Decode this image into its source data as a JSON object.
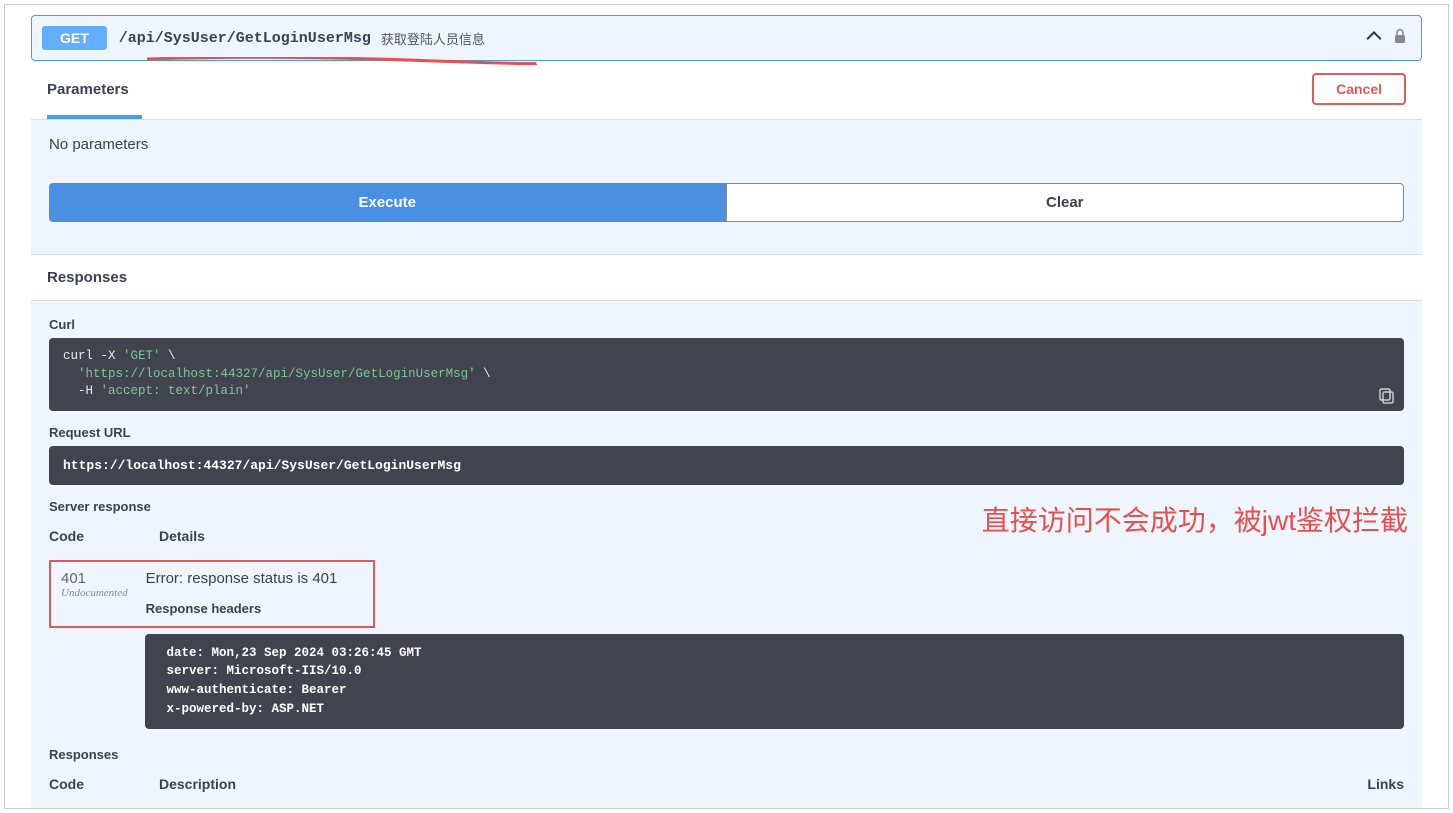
{
  "op": {
    "method": "GET",
    "path": "/api/SysUser/GetLoginUserMsg",
    "summary": "获取登陆人员信息"
  },
  "sections": {
    "parameters": "Parameters",
    "cancel": "Cancel",
    "noparams": "No parameters",
    "execute": "Execute",
    "clear": "Clear",
    "responses": "Responses",
    "curl": "Curl",
    "request_url": "Request URL",
    "server_response": "Server response",
    "code": "Code",
    "details": "Details",
    "description": "Description",
    "links": "Links",
    "responses2": "Responses"
  },
  "curl": {
    "l1a": "curl -X ",
    "l1b": "'GET'",
    "l1c": " \\",
    "l2a": "  ",
    "l2b": "'https://localhost:44327/api/SysUser/GetLoginUserMsg'",
    "l2c": " \\",
    "l3a": "  -H ",
    "l3b": "'accept: text/plain'"
  },
  "request_url": "https://localhost:44327/api/SysUser/GetLoginUserMsg",
  "response": {
    "code": "401",
    "undoc": "Undocumented",
    "error": "Error: response status is 401",
    "headers_label": "Response headers",
    "headers": " date: Mon,23 Sep 2024 03:26:45 GMT \n server: Microsoft-IIS/10.0 \n www-authenticate: Bearer \n x-powered-by: ASP.NET "
  },
  "annotation": "直接访问不会成功，被jwt鉴权拦截"
}
